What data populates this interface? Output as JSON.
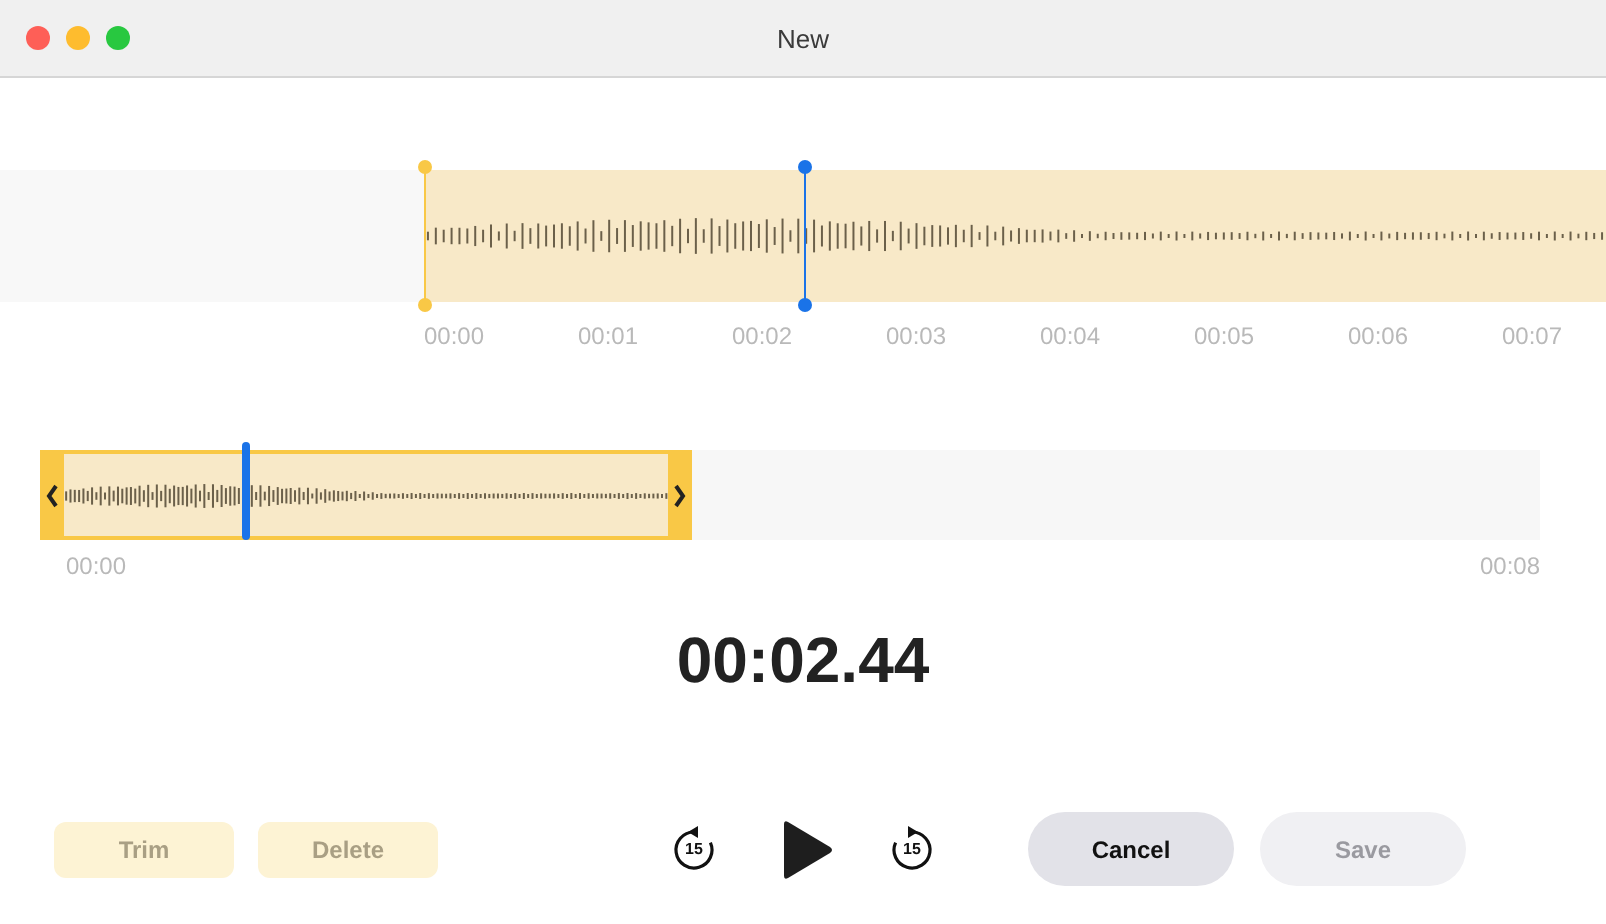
{
  "window": {
    "title": "New"
  },
  "waveform": {
    "playhead": {
      "level": 0.5
    },
    "ticks": [
      "00:00",
      "00:01",
      "00:02",
      "00:03",
      "00:04",
      "00:05",
      "00:06",
      "00:07"
    ]
  },
  "overview": {
    "selection": {
      "level": 0.435
    },
    "playhead": {
      "level": 0.137
    },
    "start_label": "00:00",
    "end_label": "00:08"
  },
  "time": "00:02.44",
  "edit_buttons": [
    {
      "label": "Trim",
      "disabled": true
    },
    {
      "label": "Delete",
      "disabled": true
    }
  ],
  "transport": {
    "skip_back": "15",
    "skip_forward": "15"
  },
  "dialog_buttons": [
    {
      "label": "Cancel",
      "disabled": false
    },
    {
      "label": "Save",
      "disabled": true
    }
  ]
}
